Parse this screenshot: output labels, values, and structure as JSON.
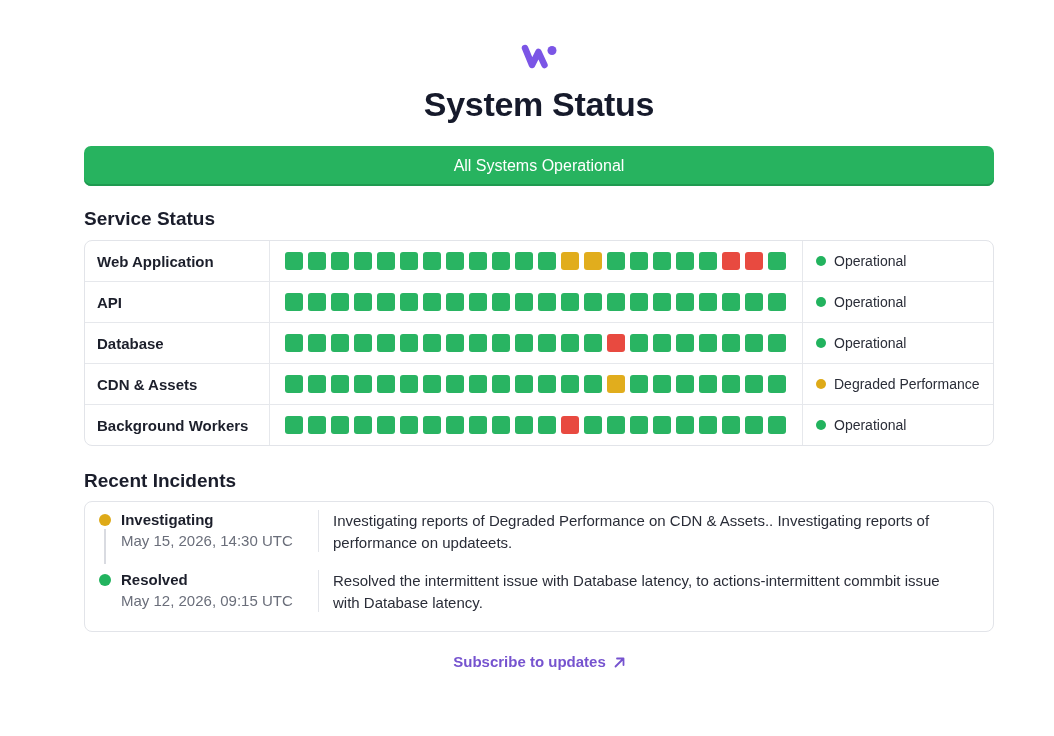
{
  "title": "System Status",
  "banner": "All Systems Operational",
  "service_status": {
    "heading": "Service Status",
    "services": [
      {
        "name": "Web Application",
        "history": [
          {
            "color": "#29b462"
          },
          {
            "color": "#29b462"
          },
          {
            "color": "#29b462"
          },
          {
            "color": "#29b462"
          },
          {
            "color": "#29b462"
          },
          {
            "color": "#29b462"
          },
          {
            "color": "#29b462"
          },
          {
            "color": "#29b462"
          },
          {
            "color": "#29b462"
          },
          {
            "color": "#29b462"
          },
          {
            "color": "#29b462"
          },
          {
            "color": "#29b462"
          },
          {
            "color": "#e1ad1d"
          },
          {
            "color": "#e1ad1d"
          },
          {
            "color": "#29b462"
          },
          {
            "color": "#29b462"
          },
          {
            "color": "#29b462"
          },
          {
            "color": "#29b462"
          },
          {
            "color": "#29b462"
          },
          {
            "color": "#e84a40"
          },
          {
            "color": "#e84a40"
          },
          {
            "color": "#29b462"
          }
        ],
        "status": {
          "label": "Operational",
          "color": "#22b35e"
        }
      },
      {
        "name": "API",
        "history": [
          {
            "color": "#29b462"
          },
          {
            "color": "#29b462"
          },
          {
            "color": "#29b462"
          },
          {
            "color": "#29b462"
          },
          {
            "color": "#29b462"
          },
          {
            "color": "#29b462"
          },
          {
            "color": "#29b462"
          },
          {
            "color": "#29b462"
          },
          {
            "color": "#29b462"
          },
          {
            "color": "#29b462"
          },
          {
            "color": "#29b462"
          },
          {
            "color": "#29b462"
          },
          {
            "color": "#29b462"
          },
          {
            "color": "#29b462"
          },
          {
            "color": "#29b462"
          },
          {
            "color": "#29b462"
          },
          {
            "color": "#29b462"
          },
          {
            "color": "#29b462"
          },
          {
            "color": "#29b462"
          },
          {
            "color": "#29b462"
          },
          {
            "color": "#29b462"
          },
          {
            "color": "#29b462"
          }
        ],
        "status": {
          "label": "Operational",
          "color": "#22b35e"
        }
      },
      {
        "name": "Database",
        "history": [
          {
            "color": "#29b462"
          },
          {
            "color": "#29b462"
          },
          {
            "color": "#29b462"
          },
          {
            "color": "#29b462"
          },
          {
            "color": "#29b462"
          },
          {
            "color": "#29b462"
          },
          {
            "color": "#29b462"
          },
          {
            "color": "#29b462"
          },
          {
            "color": "#29b462"
          },
          {
            "color": "#29b462"
          },
          {
            "color": "#29b462"
          },
          {
            "color": "#29b462"
          },
          {
            "color": "#29b462"
          },
          {
            "color": "#29b462"
          },
          {
            "color": "#e84a40"
          },
          {
            "color": "#29b462"
          },
          {
            "color": "#29b462"
          },
          {
            "color": "#29b462"
          },
          {
            "color": "#29b462"
          },
          {
            "color": "#29b462"
          },
          {
            "color": "#29b462"
          },
          {
            "color": "#29b462"
          }
        ],
        "status": {
          "label": "Operational",
          "color": "#22b35e"
        }
      },
      {
        "name": "CDN & Assets",
        "history": [
          {
            "color": "#29b462"
          },
          {
            "color": "#29b462"
          },
          {
            "color": "#29b462"
          },
          {
            "color": "#29b462"
          },
          {
            "color": "#29b462"
          },
          {
            "color": "#29b462"
          },
          {
            "color": "#29b462"
          },
          {
            "color": "#29b462"
          },
          {
            "color": "#29b462"
          },
          {
            "color": "#29b462"
          },
          {
            "color": "#29b462"
          },
          {
            "color": "#29b462"
          },
          {
            "color": "#29b462"
          },
          {
            "color": "#29b462"
          },
          {
            "color": "#e1ad1d"
          },
          {
            "color": "#29b462"
          },
          {
            "color": "#29b462"
          },
          {
            "color": "#29b462"
          },
          {
            "color": "#29b462"
          },
          {
            "color": "#29b462"
          },
          {
            "color": "#29b462"
          },
          {
            "color": "#29b462"
          }
        ],
        "status": {
          "label": "Degraded Performance",
          "color": "#deaa18"
        }
      },
      {
        "name": "Background Workers",
        "history": [
          {
            "color": "#29b462"
          },
          {
            "color": "#29b462"
          },
          {
            "color": "#29b462"
          },
          {
            "color": "#29b462"
          },
          {
            "color": "#29b462"
          },
          {
            "color": "#29b462"
          },
          {
            "color": "#29b462"
          },
          {
            "color": "#29b462"
          },
          {
            "color": "#29b462"
          },
          {
            "color": "#29b462"
          },
          {
            "color": "#29b462"
          },
          {
            "color": "#29b462"
          },
          {
            "color": "#e84a40"
          },
          {
            "color": "#29b462"
          },
          {
            "color": "#29b462"
          },
          {
            "color": "#29b462"
          },
          {
            "color": "#29b462"
          },
          {
            "color": "#29b462"
          },
          {
            "color": "#29b462"
          },
          {
            "color": "#29b462"
          },
          {
            "color": "#29b462"
          },
          {
            "color": "#29b462"
          }
        ],
        "status": {
          "label": "Operational",
          "color": "#22b35e"
        }
      }
    ]
  },
  "recent_incidents": {
    "heading": "Recent Incidents",
    "incidents": [
      {
        "status": "Investigating",
        "color": "#deaa18",
        "time": "May 15, 2026, 14:30 UTC",
        "description": "Investigating reports of Degraded Performance on CDN & Assets.. Investigating reports of performance on updateets."
      },
      {
        "status": "Resolved",
        "color": "#22b35e",
        "time": "May 12, 2026, 09:15 UTC",
        "description": "Resolved the intermittent issue with Database latency, to actions-intermittent commbit issue with Database latency."
      }
    ]
  },
  "subscribe_link": "Subscribe to updates"
}
